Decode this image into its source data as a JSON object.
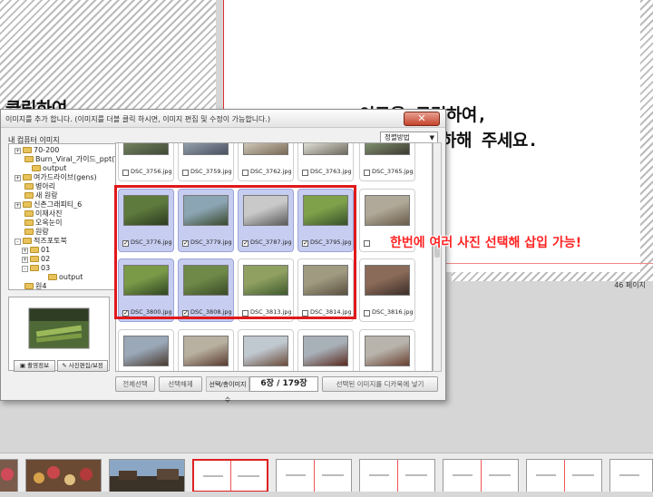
{
  "slide": {
    "text_left": "클릭하여",
    "text_right_1": "이곳을 클릭하여,",
    "text_right_2": "하해 주세요.",
    "page_number": "46 페이지"
  },
  "dialog": {
    "title": "이미지를 추가 합니다. (이미지를 더블 클릭 하시면, 이미지 편집 및 수정이 가능합니다.)",
    "close_label": "✕",
    "tree_label": "내 컴퓨터 이미지",
    "tree": [
      {
        "label": "70-200",
        "expander": "+"
      },
      {
        "label": "Burn_Viral_가이드_ppt(Tra",
        "expander": ""
      },
      {
        "label": "output",
        "expander": ""
      },
      {
        "label": "여가드라이브(gens)",
        "expander": "+"
      },
      {
        "label": "병아리",
        "expander": ""
      },
      {
        "label": "새 원랑",
        "expander": ""
      },
      {
        "label": "신촌그래피티_6",
        "expander": "+"
      },
      {
        "label": "이재사진",
        "expander": ""
      },
      {
        "label": "오옥눈이",
        "expander": ""
      },
      {
        "label": "원랑",
        "expander": ""
      },
      {
        "label": "적즈포토북",
        "expander": "-"
      },
      {
        "label": "01",
        "expander": "+"
      },
      {
        "label": "02",
        "expander": "+"
      },
      {
        "label": "03",
        "expander": "-"
      },
      {
        "label": "output",
        "expander": ""
      },
      {
        "label": "원4",
        "expander": ""
      }
    ],
    "preview_info_label": "촬영정보",
    "preview_edit_label": "사진편집/보정",
    "sort_label": "정렬방법",
    "sort_arrow": "▼",
    "rows": [
      [
        {
          "file": "DSC_3756.jpg",
          "selected": false
        },
        {
          "file": "DSC_3759.jpg",
          "selected": false
        },
        {
          "file": "DSC_3762.jpg",
          "selected": false
        },
        {
          "file": "DSC_3763.jpg",
          "selected": false
        },
        {
          "file": "DSC_3765.jpg",
          "selected": false
        }
      ],
      [
        {
          "file": "DSC_3776.jpg",
          "selected": true
        },
        {
          "file": "DSC_3779.jpg",
          "selected": true
        },
        {
          "file": "DSC_3787.jpg",
          "selected": true
        },
        {
          "file": "DSC_3795.jpg",
          "selected": true
        },
        {
          "file": "",
          "selected": false
        }
      ],
      [
        {
          "file": "DSC_3800.jpg",
          "selected": true
        },
        {
          "file": "DSC_3808.jpg",
          "selected": true
        },
        {
          "file": "DSC_3813.jpg",
          "selected": false
        },
        {
          "file": "DSC_3814.jpg",
          "selected": false
        },
        {
          "file": "DSC_3816.jpg",
          "selected": false
        }
      ],
      [
        {
          "file": "",
          "selected": false
        },
        {
          "file": "",
          "selected": false
        },
        {
          "file": "",
          "selected": false
        },
        {
          "file": "",
          "selected": false
        },
        {
          "file": "",
          "selected": false
        }
      ]
    ],
    "check_mark": "✓",
    "btn_select_all": "전체선택",
    "btn_deselect": "선택해제",
    "counter_label": "선택/총이미지수",
    "counter_value": "6장  /  179장",
    "btn_insert": "선택된 이미지를 디카북에 넣기"
  },
  "annotation": "한번에 여러 사진 선택해 삽입 가능!",
  "colors": {
    "selection_box": "#e0191b",
    "selected_cell": "#c6cdf0",
    "annotation": "#ff2424"
  }
}
